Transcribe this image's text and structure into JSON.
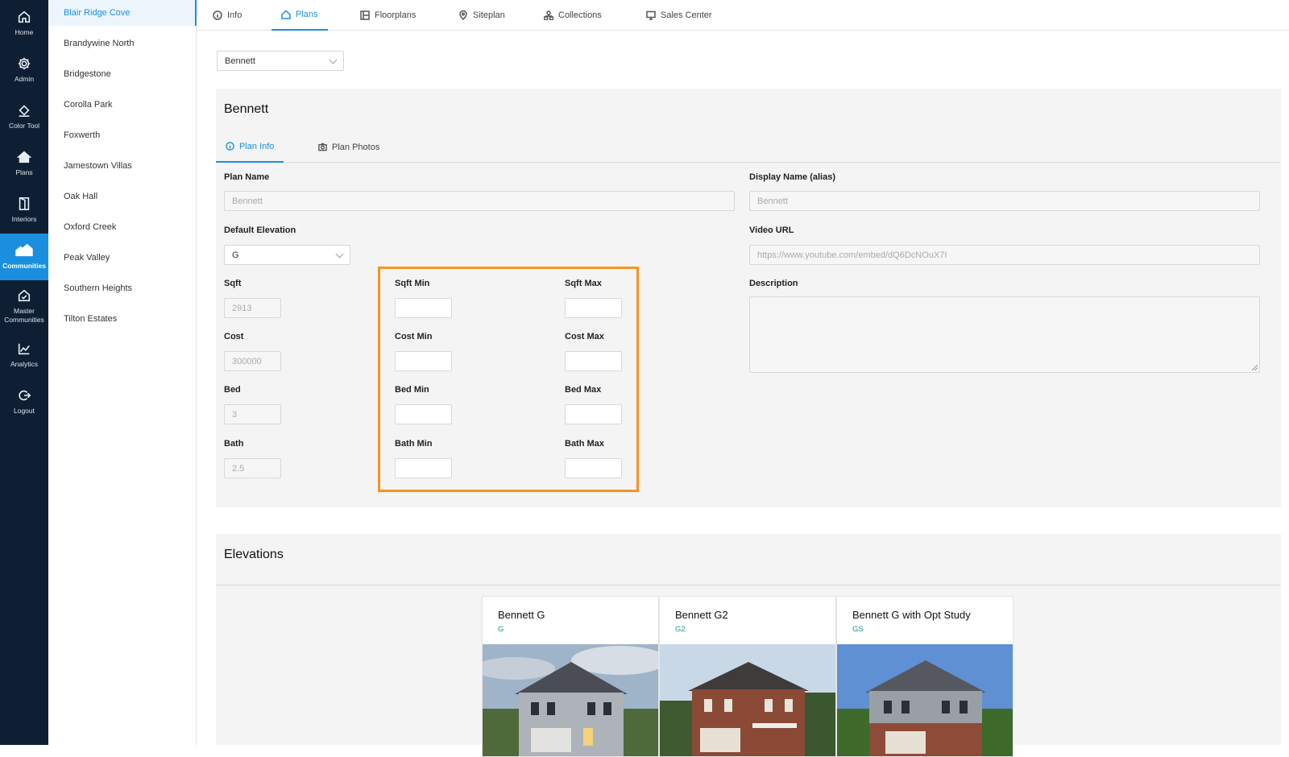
{
  "rail": [
    {
      "label": "Home",
      "icon": "home-icon"
    },
    {
      "label": "Admin",
      "icon": "gear-icon"
    },
    {
      "label": "Color Tool",
      "icon": "paint-bucket-icon"
    },
    {
      "label": "Plans",
      "icon": "house-icon"
    },
    {
      "label": "Interiors",
      "icon": "door-icon"
    },
    {
      "label": "Communities",
      "icon": "communities-icon",
      "active": true
    },
    {
      "label": "Master Communities",
      "icon": "master-communities-icon"
    },
    {
      "label": "Analytics",
      "icon": "chart-line-icon"
    },
    {
      "label": "Logout",
      "icon": "logout-icon"
    }
  ],
  "communities": [
    "Blair Ridge Cove",
    "Brandywine North",
    "Bridgestone",
    "Corolla Park",
    "Foxwerth",
    "Jamestown Villas",
    "Oak Hall",
    "Oxford Creek",
    "Peak Valley",
    "Southern Heights",
    "Tilton Estates"
  ],
  "top_tabs": [
    "Info",
    "Plans",
    "Floorplans",
    "Siteplan",
    "Collections",
    "Sales Center"
  ],
  "plan_select": {
    "value": "Bennett"
  },
  "plan": {
    "title": "Bennett",
    "sub_tabs": [
      "Plan Info",
      "Plan Photos"
    ],
    "labels": {
      "plan_name": "Plan Name",
      "display_name": "Display Name (alias)",
      "default_elevation": "Default Elevation",
      "video_url": "Video URL",
      "description": "Description",
      "sqft": "Sqft",
      "cost": "Cost",
      "bed": "Bed",
      "bath": "Bath",
      "sqft_min": "Sqft Min",
      "sqft_max": "Sqft Max",
      "cost_min": "Cost Min",
      "cost_max": "Cost Max",
      "bed_min": "Bed Min",
      "bed_max": "Bed Max",
      "bath_min": "Bath Min",
      "bath_max": "Bath Max"
    },
    "values": {
      "plan_name": "Bennett",
      "display_name": "Bennett",
      "default_elevation": "G",
      "video_url": "https://www.youtube.com/embed/dQ6DcNOuX7I",
      "sqft": "2913",
      "cost": "300000",
      "bed": "3",
      "bath": "2.5"
    }
  },
  "elevations": {
    "title": "Elevations",
    "items": [
      {
        "name": "Bennett G",
        "code": "G"
      },
      {
        "name": "Bennett G2",
        "code": "G2"
      },
      {
        "name": "Bennett G with Opt Study",
        "code": "GS"
      }
    ]
  },
  "colors": {
    "accent": "#1b8fdf",
    "rail_bg": "#0f1f33",
    "highlight": "#f7941d",
    "elevation_code": "#1b9a8f"
  }
}
